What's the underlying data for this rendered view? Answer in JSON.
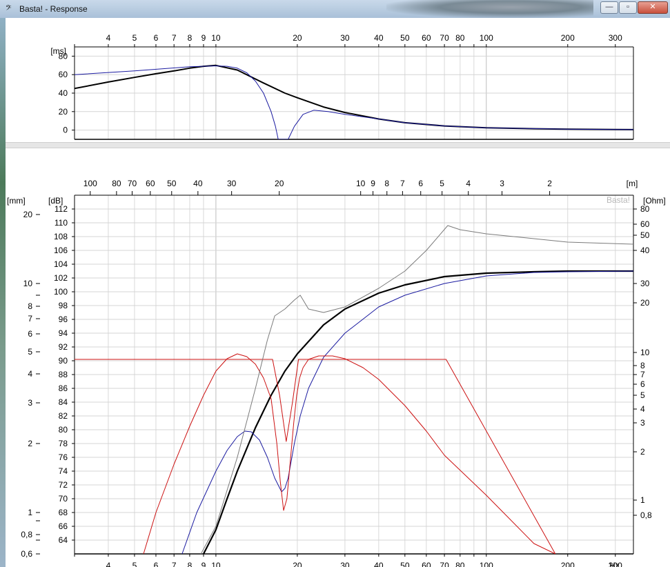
{
  "window": {
    "title": "Basta! - Response",
    "app_icon": "bass-clef-icon",
    "minimize_symbol": "—",
    "maximize_symbol": "▫",
    "close_symbol": "✕"
  },
  "chart_data": [
    {
      "type": "line",
      "panel": "group-delay",
      "ylabel": "[ms]",
      "x_scale": "log",
      "xlim": [
        3,
        350
      ],
      "ylim": [
        -10,
        90
      ],
      "grid": true,
      "x_ticks": [
        {
          "v": 4,
          "label": "4"
        },
        {
          "v": 5,
          "label": "5"
        },
        {
          "v": 6,
          "label": "6"
        },
        {
          "v": 7,
          "label": "7"
        },
        {
          "v": 8,
          "label": "8"
        },
        {
          "v": 9,
          "label": "9"
        },
        {
          "v": 10,
          "label": "10"
        },
        {
          "v": 20,
          "label": "20"
        },
        {
          "v": 30,
          "label": "30"
        },
        {
          "v": 40,
          "label": "40"
        },
        {
          "v": 50,
          "label": "50"
        },
        {
          "v": 60,
          "label": "60"
        },
        {
          "v": 70,
          "label": "70"
        },
        {
          "v": 80,
          "label": "80"
        },
        {
          "v": 100,
          "label": "100"
        },
        {
          "v": 200,
          "label": "200"
        },
        {
          "v": 300,
          "label": "300"
        }
      ],
      "y_ticks": [
        0,
        20,
        40,
        60,
        80
      ],
      "series": [
        {
          "color": "#000000",
          "width": 2,
          "x": [
            3,
            4,
            5,
            6,
            7,
            8,
            9,
            10,
            12,
            15,
            18,
            20,
            25,
            30,
            40,
            50,
            70,
            100,
            150,
            200,
            350
          ],
          "y": [
            45,
            52,
            57,
            61,
            64,
            67,
            69,
            70,
            65,
            51,
            40,
            35,
            25,
            19,
            12,
            8,
            4.5,
            2.5,
            1.5,
            1,
            0.5
          ]
        },
        {
          "color": "#1a1aa0",
          "width": 1,
          "x": [
            3,
            5,
            8,
            10,
            11,
            12,
            13,
            14,
            15,
            16,
            16.6,
            17.0,
            17.6,
            18.5,
            19.5,
            21,
            23,
            26,
            30,
            40,
            50,
            70,
            100,
            200,
            350
          ],
          "y": [
            60,
            64,
            68.5,
            69.5,
            69,
            67,
            62,
            53,
            40,
            20,
            4,
            -10,
            -10,
            -10,
            4,
            17,
            21.5,
            20,
            17,
            12,
            8,
            4.5,
            2.5,
            1,
            0.5
          ]
        }
      ]
    },
    {
      "type": "line",
      "panel": "response",
      "ylabel_left": "[mm]",
      "ylabel": "[dB]",
      "ylabel_right": "[Ohm]",
      "xlabel": "Hz",
      "x_top_label": "[m]",
      "watermark": "Basta!",
      "x_scale": "log",
      "xlim": [
        3,
        350
      ],
      "ylim": [
        62,
        114
      ],
      "grid": true,
      "x_ticks": [
        {
          "v": 4,
          "label": "4"
        },
        {
          "v": 5,
          "label": "5"
        },
        {
          "v": 6,
          "label": "6"
        },
        {
          "v": 7,
          "label": "7"
        },
        {
          "v": 8,
          "label": "8"
        },
        {
          "v": 9,
          "label": "9"
        },
        {
          "v": 10,
          "label": "10"
        },
        {
          "v": 20,
          "label": "20"
        },
        {
          "v": 30,
          "label": "30"
        },
        {
          "v": 40,
          "label": "40"
        },
        {
          "v": 50,
          "label": "50"
        },
        {
          "v": 60,
          "label": "60"
        },
        {
          "v": 70,
          "label": "70"
        },
        {
          "v": 80,
          "label": "80"
        },
        {
          "v": 100,
          "label": "100"
        },
        {
          "v": 200,
          "label": "200"
        },
        {
          "v": 300,
          "label": "300"
        }
      ],
      "x_top_ticks": [
        {
          "v": 3.43,
          "label": "100"
        },
        {
          "v": 4.29,
          "label": "80"
        },
        {
          "v": 4.9,
          "label": "70"
        },
        {
          "v": 5.72,
          "label": "60"
        },
        {
          "v": 6.86,
          "label": "50"
        },
        {
          "v": 8.58,
          "label": "40"
        },
        {
          "v": 11.43,
          "label": "30"
        },
        {
          "v": 17.15,
          "label": "20"
        },
        {
          "v": 34.3,
          "label": "10"
        },
        {
          "v": 38.1,
          "label": "9"
        },
        {
          "v": 42.9,
          "label": "8"
        },
        {
          "v": 49.0,
          "label": "7"
        },
        {
          "v": 57.2,
          "label": "6"
        },
        {
          "v": 68.6,
          "label": "5"
        },
        {
          "v": 85.8,
          "label": "4"
        },
        {
          "v": 114.3,
          "label": "3"
        },
        {
          "v": 171.5,
          "label": "2"
        }
      ],
      "y_ticks": [
        64,
        66,
        68,
        70,
        72,
        74,
        76,
        78,
        80,
        82,
        84,
        86,
        88,
        90,
        92,
        94,
        96,
        98,
        100,
        102,
        104,
        106,
        108,
        110,
        112
      ],
      "y_left_ticks": [
        {
          "label": "20",
          "db": 111.2
        },
        {
          "label": "10",
          "db": 101.2
        },
        {
          "label": "",
          "db": 99.5
        },
        {
          "label": "8",
          "db": 97.9
        },
        {
          "label": "7",
          "db": 96.1
        },
        {
          "label": "6",
          "db": 93.9
        },
        {
          "label": "5",
          "db": 91.3
        },
        {
          "label": "4",
          "db": 88.1
        },
        {
          "label": "3",
          "db": 83.9
        },
        {
          "label": "2",
          "db": 78.0
        },
        {
          "label": "1",
          "db": 68.0
        },
        {
          "label": "",
          "db": 66.8
        },
        {
          "label": "0,8",
          "db": 64.8
        },
        {
          "label": "",
          "db": 64.0
        },
        {
          "label": "0,6",
          "db": 62.0
        }
      ],
      "y_right_ticks": [
        {
          "label": "80",
          "db": 112
        },
        {
          "label": "60",
          "db": 109.8
        },
        {
          "label": "50",
          "db": 108.2
        },
        {
          "label": "40",
          "db": 106
        },
        {
          "label": "30",
          "db": 101.2
        },
        {
          "label": "20",
          "db": 98.4
        },
        {
          "label": "10",
          "db": 91.2
        },
        {
          "label": "8",
          "db": 89.3
        },
        {
          "label": "7",
          "db": 88
        },
        {
          "label": "6",
          "db": 86.6
        },
        {
          "label": "5",
          "db": 85
        },
        {
          "label": "4",
          "db": 83
        },
        {
          "label": "3",
          "db": 81
        },
        {
          "label": "2",
          "db": 76.8
        },
        {
          "label": "1",
          "db": 69.8
        },
        {
          "label": "0,8",
          "db": 67.6
        }
      ],
      "series": [
        {
          "color": "#000000",
          "width": 2.2,
          "x": [
            9,
            10,
            11,
            12,
            14,
            16,
            18,
            20,
            25,
            30,
            40,
            50,
            70,
            100,
            150,
            200,
            350
          ],
          "y": [
            62,
            65.5,
            70,
            74,
            80.3,
            85,
            88.5,
            91,
            95.2,
            97.5,
            99.8,
            101,
            102.2,
            102.7,
            102.9,
            103,
            103
          ]
        },
        {
          "color": "#1a1aa0",
          "width": 1,
          "x": [
            7.5,
            8.5,
            10,
            11,
            12,
            12.8,
            13.5,
            14.5,
            15.5,
            16.5,
            17.5,
            18,
            18.5,
            19.5,
            20.5,
            22,
            25,
            30,
            40,
            50,
            70,
            100,
            150,
            200,
            350
          ],
          "y": [
            62,
            68,
            74,
            77,
            79,
            79.8,
            79.7,
            78.5,
            76,
            73,
            71,
            71.5,
            73,
            78,
            82,
            86,
            90.5,
            94,
            97.8,
            99.5,
            101.2,
            102.3,
            102.8,
            102.9,
            103
          ]
        },
        {
          "color": "#cc1010",
          "width": 1,
          "x": [
            5.4,
            6,
            7,
            8,
            9,
            10,
            11,
            12,
            13,
            14,
            15,
            16,
            16.8,
            17.3,
            17.8,
            18.3,
            18.8,
            19.4,
            19.9,
            20.4,
            21,
            22,
            24,
            27,
            30,
            35,
            40,
            50,
            60,
            70,
            100,
            150,
            180
          ],
          "y": [
            62,
            68,
            75,
            80.5,
            85,
            88.5,
            90.3,
            91,
            90.6,
            89.5,
            87.5,
            84.5,
            78,
            72.5,
            68.3,
            70,
            75,
            81,
            85,
            87.5,
            89,
            90.2,
            90.7,
            90.7,
            90.3,
            89,
            87.3,
            83.5,
            79.8,
            76.3,
            70.5,
            63.5,
            62
          ]
        },
        {
          "color": "#cc1010",
          "width": 1,
          "x": [
            3,
            16.2,
            17.2,
            18.2,
            19.2,
            20.2,
            21.2,
            71,
            180
          ],
          "y": [
            90.2,
            90.2,
            85,
            78.3,
            84,
            90.2,
            90.2,
            90.2,
            62
          ]
        },
        {
          "color": "#7a7a7a",
          "width": 1,
          "x": [
            8.8,
            10,
            12,
            14,
            15.5,
            16.5,
            18,
            19.5,
            20.5,
            22,
            25,
            30,
            40,
            50,
            60,
            72,
            80,
            100,
            150,
            200,
            350
          ],
          "y": [
            62,
            66,
            76,
            86,
            93,
            96.5,
            97.5,
            98.8,
            99.5,
            97.5,
            97,
            97.8,
            100.5,
            103,
            106,
            109.6,
            109,
            108.4,
            107.7,
            107.2,
            106.9
          ]
        }
      ]
    }
  ]
}
